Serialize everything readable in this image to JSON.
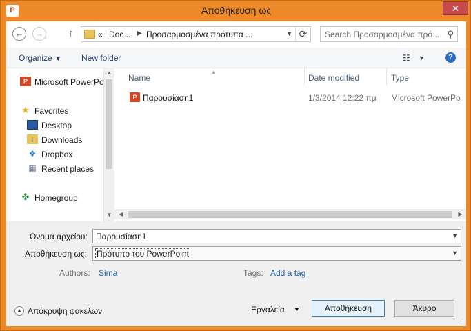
{
  "window": {
    "title": "Αποθήκευση ως",
    "app_icon": "P"
  },
  "nav": {
    "back": "←",
    "forward": "→",
    "up": "↑",
    "breadcrumb_overflow": "«",
    "path": [
      "Doc...",
      "Προσαρμοσμένα πρότυπα ..."
    ],
    "refresh": "⟳",
    "search_placeholder": "Search Προσαρμοσμένα πρό..."
  },
  "toolbar": {
    "organize": "Organize",
    "new_folder": "New folder",
    "help": "?"
  },
  "sidebar": {
    "items": [
      {
        "label": "Microsoft PowerPo",
        "icon": "powerpoint-icon"
      },
      {
        "label": "Favorites",
        "icon": "star-icon"
      },
      {
        "label": "Desktop",
        "icon": "desktop-icon"
      },
      {
        "label": "Downloads",
        "icon": "downloads-icon"
      },
      {
        "label": "Dropbox",
        "icon": "dropbox-icon"
      },
      {
        "label": "Recent places",
        "icon": "recent-places-icon"
      },
      {
        "label": "Homegroup",
        "icon": "homegroup-icon"
      }
    ]
  },
  "files": {
    "columns": [
      "Name",
      "Date modified",
      "Type"
    ],
    "rows": [
      {
        "name": "Παρουσίαση1",
        "date": "1/3/2014 12:22 πμ",
        "type": "Microsoft PowerPo"
      }
    ]
  },
  "form": {
    "filename_label": "Όνομα αρχείου:",
    "filename_value": "Παρουσίαση1",
    "saveas_label": "Αποθήκευση ως:",
    "saveas_value": "Πρότυπο του PowerPoint",
    "authors_label": "Authors:",
    "authors_value": "Sima",
    "tags_label": "Tags:",
    "tags_value": "Add a tag"
  },
  "footer": {
    "hide_folders": "Απόκρυψη φακέλων",
    "tools": "Εργαλεία",
    "save": "Αποθήκευση",
    "cancel": "Άκυρο"
  },
  "colors": {
    "frame": "#ec8a2a",
    "close": "#c74a4a",
    "link": "#1f5fad",
    "accent": "#2a6cc7"
  }
}
